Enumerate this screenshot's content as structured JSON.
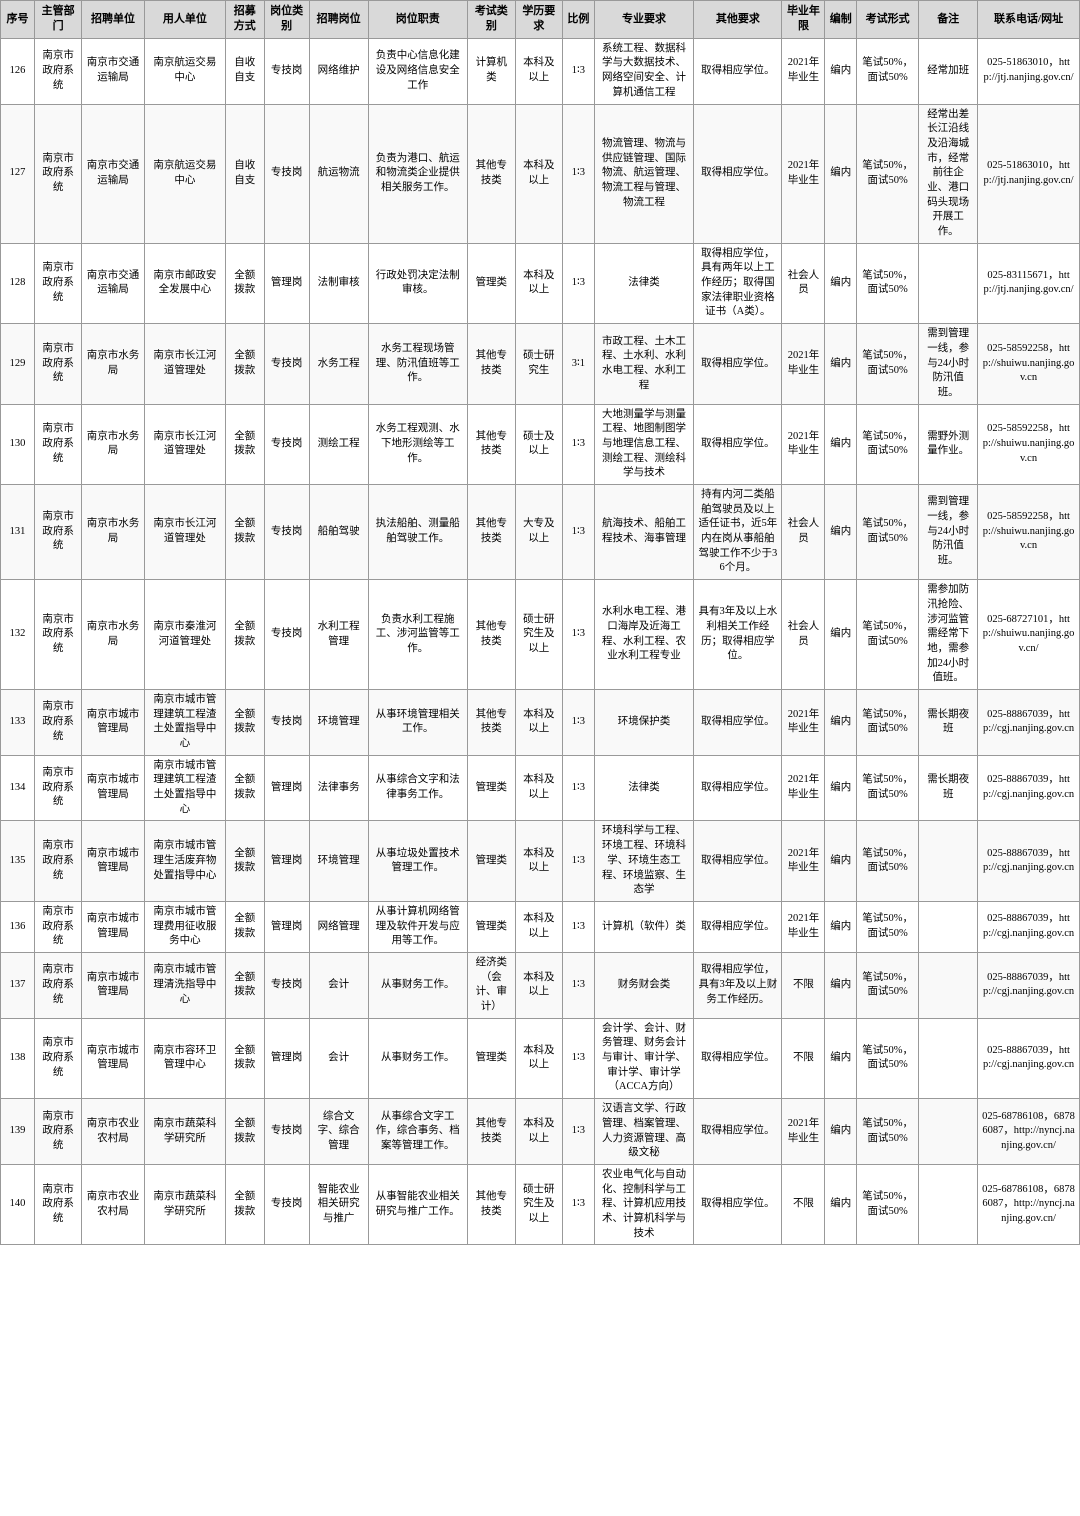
{
  "headers": [
    "序号",
    "主管部门",
    "招聘单位",
    "主管部门",
    "用人单位",
    "招募方式",
    "岗位类别",
    "招聘岗位",
    "岗位职责",
    "考试类别",
    "学历",
    "比例",
    "专业要求",
    "其他要求",
    "毕业年限",
    "编制",
    "考试形式",
    "备注",
    "联系电话/网址"
  ],
  "rows": [
    {
      "seq": "126",
      "sys": "南京市政府系统",
      "dept1": "南京市交通运输局",
      "unit": "南京航运交易中心",
      "recruit": "自收自支",
      "post_type": "专技岗",
      "post_cat": "网络维护",
      "duty": "负责中心信息化建设及网络信息安全工作",
      "exam_type": "计算机类",
      "degree": "本科及以上",
      "ratio": "1∶3",
      "edu_req": "本科及以上",
      "major": "系统工程、数据科学与大数据技术、网络空间安全、计算机通信工程",
      "other": "取得相应学位。",
      "year": "2021年毕业生",
      "bianzhi": "编内",
      "exam": "笔试50%，面试50%",
      "note": "经常加班",
      "tel": "025-51863010，http://jtj.nanjing.gov.cn/"
    },
    {
      "seq": "127",
      "sys": "南京市政府系统",
      "dept1": "南京市交通运输局",
      "unit": "南京航运交易中心",
      "recruit": "自收自支",
      "post_type": "专技岗",
      "post_cat": "航运物流",
      "duty": "负责为港口、航运和物流类企业提供相关服务工作。",
      "exam_type": "其他专技类",
      "degree": "本科及以上",
      "ratio": "1∶3",
      "edu_req": "本科及以上",
      "major": "物流管理、物流与供应链管理、国际物流、航运管理、物流工程与管理、物流工程",
      "other": "取得相应学位。",
      "year": "2021年毕业生",
      "bianzhi": "编内",
      "exam": "笔试50%，面试50%",
      "note": "经常出差长江沿线及沿海城市，经常前往企业、港口码头现场开展工作。",
      "tel": "025-51863010，http://jtj.nanjing.gov.cn/"
    },
    {
      "seq": "128",
      "sys": "南京市政府系统",
      "dept1": "南京市交通运输局",
      "unit": "南京市邮政安全发展中心",
      "recruit": "全额拨款",
      "post_type": "管理岗",
      "post_cat": "法制审核",
      "duty": "行政处罚决定法制审核。",
      "exam_type": "管理类",
      "degree": "本科及以上",
      "ratio": "1∶3",
      "edu_req": "本科及以上",
      "major": "法律类",
      "other": "取得相应学位，具有两年以上工作经历；取得国家法律职业资格证书（A类）。",
      "year": "社会人员",
      "bianzhi": "编内",
      "exam": "笔试50%，面试50%",
      "note": "",
      "tel": "025-83115671，http://jtj.nanjing.gov.cn/"
    },
    {
      "seq": "129",
      "sys": "南京市政府系统",
      "dept1": "南京市水务局",
      "unit": "南京市长江河道管理处",
      "recruit": "全额拨款",
      "post_type": "专技岗",
      "post_cat": "水务工程",
      "duty": "水务工程现场管理、防汛值班等工作。",
      "exam_type": "其他专技类",
      "degree": "硕士研究生",
      "ratio": "3∶1",
      "edu_req": "硕士研究生",
      "major": "市政工程、土木工程、土水利、水利水电工程、水利工程",
      "other": "取得相应学位。",
      "year": "2021年毕业生",
      "bianzhi": "编内",
      "exam": "笔试50%，面试50%",
      "note": "需到管理一线，参与24小时防汛值班。",
      "tel": "025-58592258，http://shuiwu.nanjing.gov.cn"
    },
    {
      "seq": "130",
      "sys": "南京市政府系统",
      "dept1": "南京市水务局",
      "unit": "南京市长江河道管理处",
      "recruit": "全额拨款",
      "post_type": "专技岗",
      "post_cat": "测绘工程",
      "duty": "水务工程观测、水下地形测绘等工作。",
      "exam_type": "其他专技类",
      "degree": "硕士及以上",
      "ratio": "1∶3",
      "edu_req": "硕士及以上",
      "major": "大地测量学与测量工程、地图制图学与地理信息工程、测绘工程、测绘科学与技术",
      "other": "取得相应学位。",
      "year": "2021年毕业生",
      "bianzhi": "编内",
      "exam": "笔试50%，面试50%",
      "note": "需野外测量作业。",
      "tel": "025-58592258，http://shuiwu.nanjing.gov.cn"
    },
    {
      "seq": "131",
      "sys": "南京市政府系统",
      "dept1": "南京市水务局",
      "unit": "南京市长江河道管理处",
      "recruit": "全额拨款",
      "post_type": "专技岗",
      "post_cat": "船舶驾驶",
      "duty": "执法船舶、测量船舶驾驶工作。",
      "exam_type": "其他专技类",
      "degree": "大专及以上",
      "ratio": "1∶3",
      "edu_req": "大专及以上",
      "major": "航海技术、船舶工程技术、海事管理",
      "other": "持有内河二类船舶驾驶员及以上适任证书，近5年内在岗从事船舶驾驶工作不少于36个月。",
      "year": "社会人员",
      "bianzhi": "编内",
      "exam": "笔试50%，面试50%",
      "note": "需到管理一线，参与24小时防汛值班。",
      "tel": "025-58592258，http://shuiwu.nanjing.gov.cn"
    },
    {
      "seq": "132",
      "sys": "南京市政府系统",
      "dept1": "南京市水务局",
      "unit": "南京市秦淮河河道管理处",
      "recruit": "全额拨款",
      "post_type": "专技岗",
      "post_cat": "水利工程管理",
      "duty": "负责水利工程施工、涉河监管等工作。",
      "exam_type": "其他专技类",
      "degree": "硕士研究生及以上",
      "ratio": "1∶3",
      "edu_req": "硕士研究生及以上",
      "major": "水利水电工程、港口海岸及近海工程、水利工程、农业水利工程专业",
      "other": "具有3年及以上水利相关工作经历；取得相应学位。",
      "year": "社会人员",
      "bianzhi": "编内",
      "exam": "笔试50%，面试50%",
      "note": "需参加防汛抢险、涉河监管需经常下地，需参加24小时值班。",
      "tel": "025-68727101，http://shuiwu.nanjing.gov.cn/"
    },
    {
      "seq": "133",
      "sys": "南京市政府系统",
      "dept1": "南京市城市管理局",
      "unit": "南京市城市管理建筑工程渣土处置指导中心",
      "recruit": "全额拨款",
      "post_type": "专技岗",
      "post_cat": "环境管理",
      "duty": "从事环境管理相关工作。",
      "exam_type": "其他专技类",
      "degree": "本科及以上",
      "ratio": "1∶3",
      "edu_req": "本科及以上",
      "major": "环境保护类",
      "other": "取得相应学位。",
      "year": "2021年毕业生",
      "bianzhi": "编内",
      "exam": "笔试50%，面试50%",
      "note": "需长期夜班",
      "tel": "025-88867039，http://cgj.nanjing.gov.cn"
    },
    {
      "seq": "134",
      "sys": "南京市政府系统",
      "dept1": "南京市城市管理局",
      "unit": "南京市城市管理建筑工程渣土处置指导中心",
      "recruit": "全额拨款",
      "post_type": "管理岗",
      "post_cat": "法律事务",
      "duty": "从事综合文字和法律事务工作。",
      "exam_type": "管理类",
      "degree": "本科及以上",
      "ratio": "1∶3",
      "edu_req": "本科及以上",
      "major": "法律类",
      "other": "取得相应学位。",
      "year": "2021年毕业生",
      "bianzhi": "编内",
      "exam": "笔试50%，面试50%",
      "note": "需长期夜班",
      "tel": "025-88867039，http://cgj.nanjing.gov.cn"
    },
    {
      "seq": "135",
      "sys": "南京市政府系统",
      "dept1": "南京市城市管理局",
      "unit": "南京市城市管理生活废弃物处置指导中心",
      "recruit": "全额拨款",
      "post_type": "管理岗",
      "post_cat": "环境管理",
      "duty": "从事垃圾处置技术管理工作。",
      "exam_type": "管理类",
      "degree": "本科及以上",
      "ratio": "1∶3",
      "edu_req": "本科及以上",
      "major": "环境科学与工程、环境工程、环境科学、环境生态工程、环境监察、生态学",
      "other": "取得相应学位。",
      "year": "2021年毕业生",
      "bianzhi": "编内",
      "exam": "笔试50%，面试50%",
      "note": "",
      "tel": "025-88867039，http://cgj.nanjing.gov.cn"
    },
    {
      "seq": "136",
      "sys": "南京市政府系统",
      "dept1": "南京市城市管理局",
      "unit": "南京市城市管理费用征收服务中心",
      "recruit": "全额拨款",
      "post_type": "管理岗",
      "post_cat": "网络管理",
      "duty": "从事计算机网络管理及软件开发与应用等工作。",
      "exam_type": "管理类",
      "degree": "本科及以上",
      "ratio": "1∶3",
      "edu_req": "本科及以上",
      "major": "计算机（软件）类",
      "other": "取得相应学位。",
      "year": "2021年毕业生",
      "bianzhi": "编内",
      "exam": "笔试50%，面试50%",
      "note": "",
      "tel": "025-88867039，http://cgj.nanjing.gov.cn"
    },
    {
      "seq": "137",
      "sys": "南京市政府系统",
      "dept1": "南京市城市管理局",
      "unit": "南京市城市管理清洗指导中心",
      "recruit": "全额拨款",
      "post_type": "专技岗",
      "post_cat": "会计",
      "duty": "从事财务工作。",
      "exam_type": "经济类（会计、审计）",
      "degree": "本科及以上",
      "ratio": "1∶3",
      "edu_req": "本科及以上",
      "major": "财务财会类",
      "other": "取得相应学位，具有3年及以上财务工作经历。",
      "year": "不限",
      "bianzhi": "编内",
      "exam": "笔试50%，面试50%",
      "note": "",
      "tel": "025-88867039，http://cgj.nanjing.gov.cn"
    },
    {
      "seq": "138",
      "sys": "南京市政府系统",
      "dept1": "南京市城市管理局",
      "unit": "南京市容环卫管理中心",
      "recruit": "全额拨款",
      "post_type": "管理岗",
      "post_cat": "会计",
      "duty": "从事财务工作。",
      "exam_type": "管理类",
      "degree": "本科及以上",
      "ratio": "1∶3",
      "edu_req": "本科及以上",
      "major": "会计学、会计、财务管理、财务会计与审计、审计学、审计学、审计学（ACCA方向）",
      "other": "取得相应学位。",
      "year": "不限",
      "bianzhi": "编内",
      "exam": "笔试50%，面试50%",
      "note": "",
      "tel": "025-88867039，http://cgj.nanjing.gov.cn"
    },
    {
      "seq": "139",
      "sys": "南京市政府系统",
      "dept1": "南京市农业农村局",
      "unit": "南京市蔬菜科学研究所",
      "recruit": "全额拨款",
      "post_type": "专技岗",
      "post_cat": "综合文字、综合管理",
      "duty": "从事综合文字工作，综合事务、档案等管理工作。",
      "exam_type": "其他专技类",
      "degree": "本科及以上",
      "ratio": "1∶3",
      "edu_req": "本科及以上",
      "major": "汉语言文学、行政管理、档案管理、人力资源管理、高级文秘",
      "other": "取得相应学位。",
      "year": "2021年毕业生",
      "bianzhi": "编内",
      "exam": "笔试50%，面试50%",
      "note": "",
      "tel": "025-68786108，68786087，http://nyncj.nanjing.gov.cn/"
    },
    {
      "seq": "140",
      "sys": "南京市政府系统",
      "dept1": "南京市农业农村局",
      "unit": "南京市蔬菜科学研究所",
      "recruit": "全额拨款",
      "post_type": "专技岗",
      "post_cat": "智能农业相关研究与推广",
      "duty": "从事智能农业相关研究与推广工作。",
      "exam_type": "其他专技类",
      "degree": "硕士研究生及以上",
      "ratio": "1∶3",
      "edu_req": "硕士研究生及以上",
      "major": "农业电气化与自动化、控制科学与工程、计算机应用技术、计算机科学与技术",
      "other": "取得相应学位。",
      "year": "不限",
      "bianzhi": "编内",
      "exam": "笔试50%，面试50%",
      "note": "",
      "tel": "025-68786108，68786087，http://nyncj.nanjing.gov.cn/"
    }
  ]
}
